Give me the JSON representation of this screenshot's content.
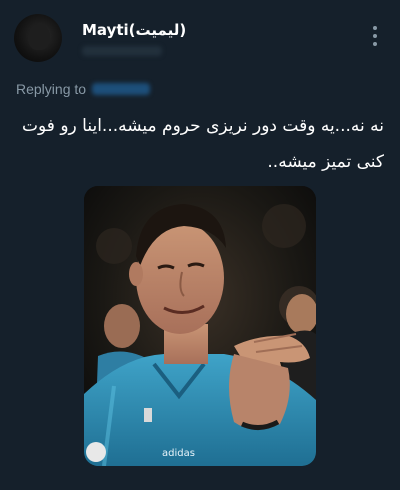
{
  "tweet": {
    "display_name": "Mayti(لیمیت)",
    "replying_to_label": "Replying to",
    "text": "نه نه...یه وقت دور نریزی حروم میشه...اینا رو فوت کنی تمیز میشه..",
    "media_icon": "photo-of-soccer-player-in-teal-jersey"
  },
  "colors": {
    "background": "#15202b",
    "text_primary": "#ffffff",
    "text_secondary": "#8899a6",
    "link": "#1da1f2"
  }
}
